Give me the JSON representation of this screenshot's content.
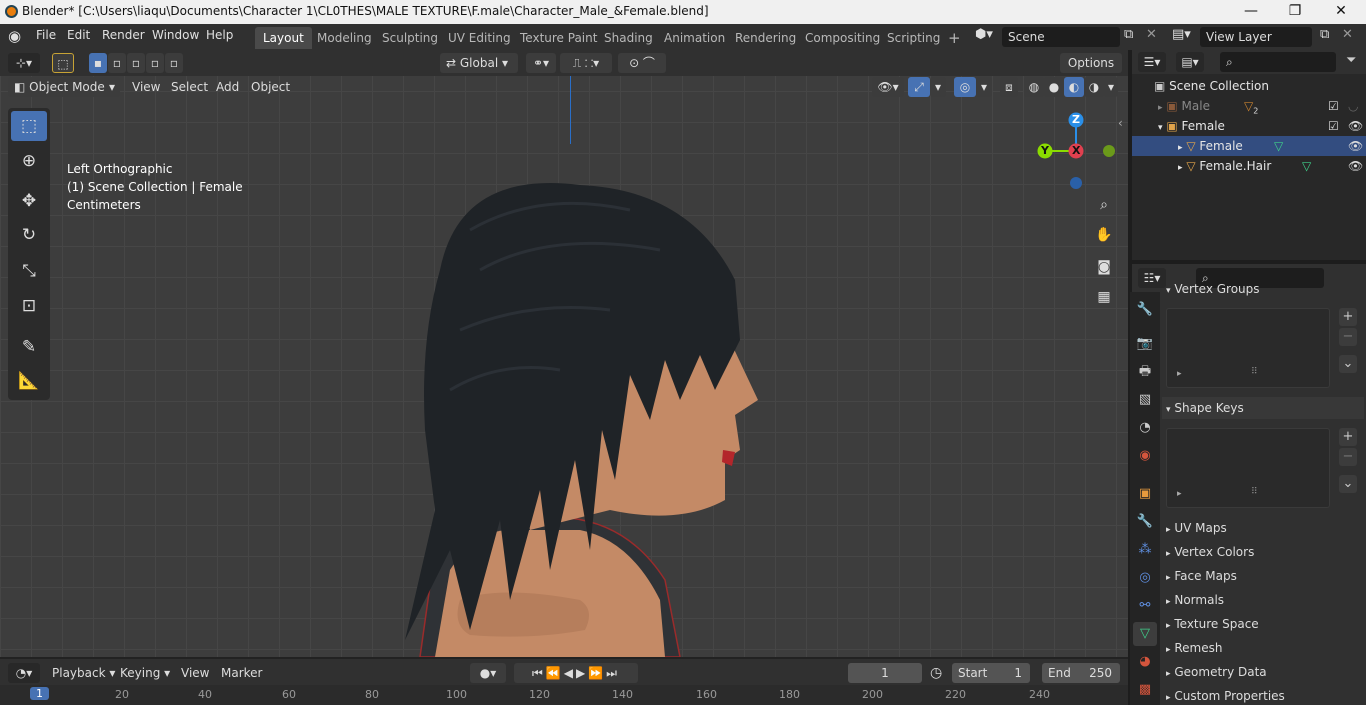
{
  "window": {
    "title": "Blender* [C:\\Users\\liaqu\\Documents\\Character 1\\CL0THES\\MALE TEXTURE\\F.male\\Character_Male_&Female.blend]",
    "minimize": "—",
    "maximize": "❐",
    "close": "✕"
  },
  "menu": [
    "File",
    "Edit",
    "Render",
    "Window",
    "Help"
  ],
  "workspaces": [
    "Layout",
    "Modeling",
    "Sculpting",
    "UV Editing",
    "Texture Paint",
    "Shading",
    "Animation",
    "Rendering",
    "Compositing",
    "Scripting"
  ],
  "workspace_add": "+",
  "scene": {
    "name": "Scene",
    "view_layer": "View Layer"
  },
  "viewport_header": {
    "transform_orientation": "Global",
    "options": "Options",
    "mode": "Object Mode",
    "menus": [
      "View",
      "Select",
      "Add",
      "Object"
    ]
  },
  "viewport": {
    "view_name": "Left Orthographic",
    "collection_info": "(1) Scene Collection | Female",
    "units": "Centimeters",
    "gizmo": {
      "z": "Z",
      "y": "Y",
      "x": "X"
    }
  },
  "outliner": {
    "root": "Scene Collection",
    "items": [
      {
        "label": "Male",
        "badge": "2"
      },
      {
        "label": "Female"
      },
      {
        "label": "Female"
      },
      {
        "label": "Female.Hair"
      }
    ]
  },
  "properties": {
    "sections": {
      "vertex_groups": "Vertex Groups",
      "shape_keys": "Shape Keys",
      "collapsed": [
        "UV Maps",
        "Vertex Colors",
        "Face Maps",
        "Normals",
        "Texture Space",
        "Remesh",
        "Geometry Data",
        "Custom Properties"
      ]
    },
    "add": "+",
    "remove": "−",
    "more": "⌄"
  },
  "timeline": {
    "menus": [
      "Playback",
      "Keying",
      "View",
      "Marker"
    ],
    "current_frame": "1",
    "start_label": "Start",
    "start": "1",
    "end_label": "End",
    "end": "250",
    "ruler": [
      "1",
      "20",
      "40",
      "60",
      "80",
      "100",
      "120",
      "140",
      "160",
      "180",
      "200",
      "220",
      "240"
    ]
  },
  "colors": {
    "accent": "#4772b3",
    "skin": "#c48a66",
    "hair": "#1f2327",
    "grid": "#3d3d3d",
    "axis_x": "#e0404f",
    "axis_y": "#8bdc00",
    "axis_z": "#2a8fe8"
  }
}
